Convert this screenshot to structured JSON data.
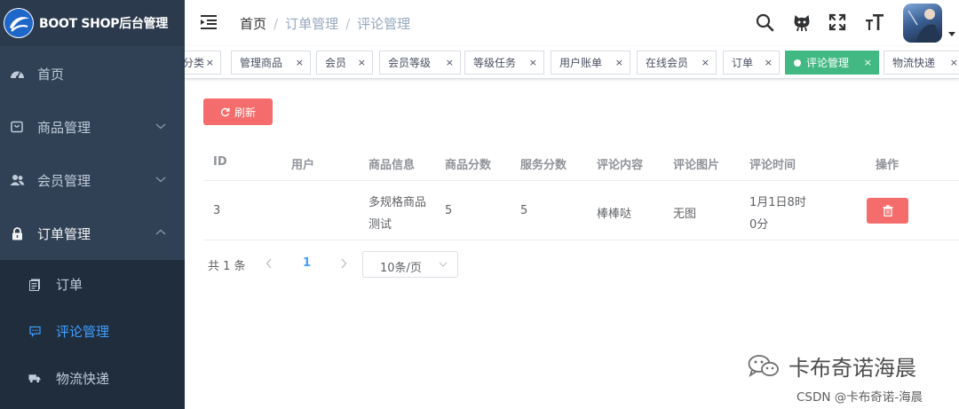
{
  "app": {
    "title": "BOOT SHOP后台管理"
  },
  "sidebar": {
    "items": [
      {
        "label": "首页",
        "icon": "dashboard-icon"
      },
      {
        "label": "商品管理",
        "icon": "shop-icon"
      },
      {
        "label": "会员管理",
        "icon": "peoples-icon"
      },
      {
        "label": "订单管理",
        "icon": "lock-icon"
      }
    ],
    "submenu": [
      {
        "label": "订单",
        "icon": "documentation-icon"
      },
      {
        "label": "评论管理",
        "icon": "message-icon"
      },
      {
        "label": "物流快递",
        "icon": "truck-icon"
      }
    ],
    "colors": {
      "bg": "#304156",
      "sub_bg": "#1f2d3d",
      "text": "#bfcbd9",
      "active": "#409eff"
    }
  },
  "breadcrumb": [
    "首页",
    "订单管理",
    "评论管理"
  ],
  "tags": [
    {
      "label": "分类"
    },
    {
      "label": "管理商品"
    },
    {
      "label": "会员"
    },
    {
      "label": "会员等级"
    },
    {
      "label": "等级任务"
    },
    {
      "label": "用户账单"
    },
    {
      "label": "在线会员"
    },
    {
      "label": "订单"
    },
    {
      "label": "评论管理",
      "active": true
    },
    {
      "label": "物流快递"
    }
  ],
  "close_glyph": "×",
  "toolbar": {
    "refresh_label": "刷新"
  },
  "table": {
    "headers": [
      "ID",
      "用户",
      "商品信息",
      "商品分数",
      "服务分数",
      "评论内容",
      "评论图片",
      "评论时间",
      "操作"
    ],
    "rows": [
      {
        "id": "3",
        "user": "",
        "product_line1": "多规格商品",
        "product_line2": "测试",
        "product_score": "5",
        "service_score": "5",
        "content": "棒棒哒",
        "image": "无图",
        "time_line1": "1月1日8时",
        "time_line2": "0分"
      }
    ]
  },
  "pagination": {
    "total": "共 1 条",
    "current": "1",
    "page_size": "10条/页"
  },
  "watermark": {
    "line1": "卡布奇诺海晨",
    "line2": "CSDN @卡布奇诺-海晨"
  },
  "colors": {
    "danger": "#f56c6c",
    "success": "#42b983",
    "primary": "#409eff"
  }
}
